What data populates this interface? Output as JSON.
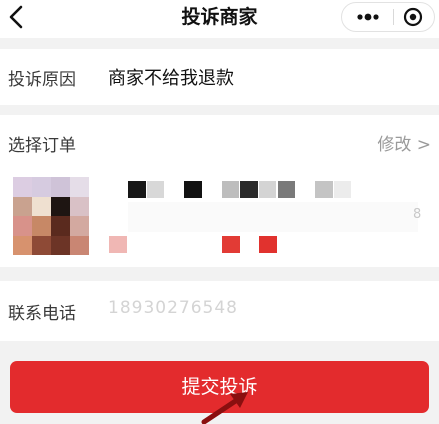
{
  "navbar": {
    "back_icon": "chevron-left-icon",
    "title": "投诉商家",
    "more_icon": "more-dots-icon",
    "close_icon": "target-close-icon"
  },
  "reason": {
    "label": "投诉原因",
    "value": "商家不给我退款"
  },
  "order": {
    "label": "选择订单",
    "modify_label": "修改 >",
    "qty_suffix": "8"
  },
  "contact": {
    "label": "联系电话",
    "phone_value": "18930276548"
  },
  "submit_label": "提交投诉",
  "colors": {
    "accent_red": "#e32b2d",
    "page_bg": "#f2f2f2"
  }
}
